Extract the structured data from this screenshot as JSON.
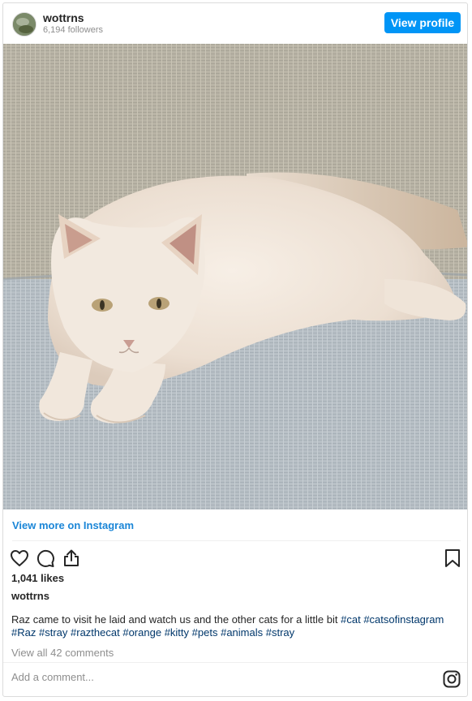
{
  "header": {
    "username": "wottrns",
    "followers": "6,194 followers",
    "view_profile_label": "View profile"
  },
  "post": {
    "view_more_label": "View more on Instagram",
    "likes": "1,041 likes",
    "caption_user": "wottrns",
    "caption_text": "Raz came to visit he laid and watch us and the other cats for a little bit ",
    "hashtags": [
      "#cat",
      "#catsofinstagram",
      "#Raz",
      "#stray",
      "#razthecat",
      "#orange",
      "#kitty",
      "#pets",
      "#animals",
      "#stray"
    ],
    "view_comments_label": "View all 42 comments"
  },
  "comment_bar": {
    "placeholder": "Add a comment..."
  },
  "icons": {
    "like": "heart-icon",
    "comment": "comment-icon",
    "share": "share-icon",
    "save": "bookmark-icon",
    "logo": "instagram-logo-icon"
  },
  "colors": {
    "accent": "#0095f6",
    "link": "#1b86d7",
    "hashtag": "#00376b",
    "muted": "#8e8e8e"
  }
}
